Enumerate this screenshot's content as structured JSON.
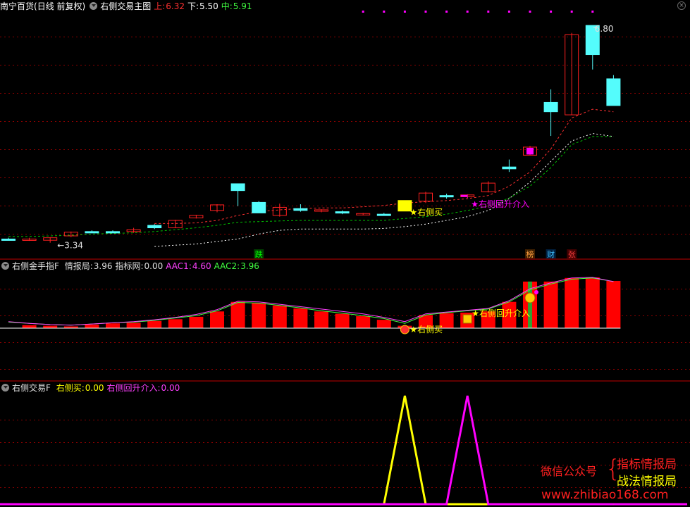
{
  "header": {
    "stock": "南宁百货",
    "period": "(日线 前复权)",
    "indicator": "右侧交易主图",
    "up_label": "上:",
    "up_value": "6.32",
    "down_label": "下:",
    "down_value": "5.50",
    "mid_label": "中:",
    "mid_value": "5.91"
  },
  "panel2": {
    "name": "右侧金手指F",
    "items": [
      {
        "label": "情报局:",
        "value": "3.96",
        "color": "#e0e0e0"
      },
      {
        "label": "指标网:",
        "value": "0.00",
        "color": "#e0e0e0"
      },
      {
        "label": "AAC1:",
        "value": "4.60",
        "color": "#ff40ff"
      },
      {
        "label": "AAC2:",
        "value": "3.96",
        "color": "#40ff40"
      }
    ]
  },
  "panel3": {
    "name": "右侧交易F",
    "items": [
      {
        "label": "右侧买:",
        "value": "0.00",
        "color": "#ffff00"
      },
      {
        "label": "右侧回升介入:",
        "value": "0.00",
        "color": "#ff40ff"
      }
    ]
  },
  "watermark": {
    "wechat": "微信公众号",
    "line1": "指标情报局",
    "line2": "战法情报局",
    "url": "www.zhibiao168.com"
  },
  "colors": {
    "up": "#ff2020",
    "down": "#54fcfc",
    "yellow": "#ffff00",
    "magenta": "#ff00ff",
    "green_line": "#00c000",
    "red_line": "#ff3030",
    "white_line": "#ffffff",
    "grid": "#8b0000"
  },
  "chart_data": [
    {
      "type": "candlestick",
      "title": "右侧交易主图",
      "annotations": {
        "high_label": "6.80",
        "low_label": "3.34",
        "buy_label": "右侧买",
        "rebound_label": "右侧回升介入",
        "tags": [
          {
            "text": "跌",
            "bar": 12,
            "color": "#00ff00",
            "bg": "#004000"
          },
          {
            "text": "榜",
            "bar": 25,
            "color": "#ffa040",
            "bg": "#402000"
          },
          {
            "text": "财",
            "bar": 26,
            "color": "#40c0ff",
            "bg": "#002040"
          },
          {
            "text": "张",
            "bar": 27,
            "color": "#ff4040",
            "bg": "#400000"
          }
        ]
      },
      "ylim": [
        3.28,
        7.0
      ],
      "candles": [
        {
          "o": 3.4,
          "h": 3.42,
          "l": 3.38,
          "c": 3.4,
          "kind": "down"
        },
        {
          "o": 3.38,
          "h": 3.42,
          "l": 3.37,
          "c": 3.4,
          "kind": "up"
        },
        {
          "o": 3.38,
          "h": 3.43,
          "l": 3.34,
          "c": 3.42,
          "kind": "up"
        },
        {
          "o": 3.45,
          "h": 3.52,
          "l": 3.43,
          "c": 3.51,
          "kind": "up"
        },
        {
          "o": 3.52,
          "h": 3.54,
          "l": 3.5,
          "c": 3.52,
          "kind": "down"
        },
        {
          "o": 3.52,
          "h": 3.54,
          "l": 3.5,
          "c": 3.52,
          "kind": "down"
        },
        {
          "o": 3.52,
          "h": 3.58,
          "l": 3.5,
          "c": 3.55,
          "kind": "up"
        },
        {
          "o": 3.62,
          "h": 3.64,
          "l": 3.56,
          "c": 3.58,
          "kind": "down"
        },
        {
          "o": 3.58,
          "h": 3.71,
          "l": 3.58,
          "c": 3.7,
          "kind": "up"
        },
        {
          "o": 3.74,
          "h": 3.79,
          "l": 3.73,
          "c": 3.78,
          "kind": "up"
        },
        {
          "o": 3.86,
          "h": 3.96,
          "l": 3.83,
          "c": 3.95,
          "kind": "up"
        },
        {
          "o": 4.29,
          "h": 4.29,
          "l": 3.93,
          "c": 4.18,
          "kind": "down"
        },
        {
          "o": 3.99,
          "h": 4.01,
          "l": 3.82,
          "c": 3.82,
          "kind": "down"
        },
        {
          "o": 3.78,
          "h": 3.97,
          "l": 3.76,
          "c": 3.91,
          "kind": "up"
        },
        {
          "o": 3.89,
          "h": 3.96,
          "l": 3.84,
          "c": 3.86,
          "kind": "down"
        },
        {
          "o": 3.86,
          "h": 3.88,
          "l": 3.83,
          "c": 3.87,
          "kind": "up"
        },
        {
          "o": 3.84,
          "h": 3.86,
          "l": 3.8,
          "c": 3.83,
          "kind": "down"
        },
        {
          "o": 3.8,
          "h": 3.82,
          "l": 3.78,
          "c": 3.81,
          "kind": "up"
        },
        {
          "o": 3.8,
          "h": 3.82,
          "l": 3.78,
          "c": 3.79,
          "kind": "down"
        },
        {
          "o": 3.85,
          "h": 4.02,
          "l": 3.85,
          "c": 4.02,
          "kind": "buy"
        },
        {
          "o": 4.01,
          "h": 4.16,
          "l": 3.98,
          "c": 4.14,
          "kind": "up"
        },
        {
          "o": 4.1,
          "h": 4.13,
          "l": 4.05,
          "c": 4.08,
          "kind": "down"
        },
        {
          "o": 4.08,
          "h": 4.12,
          "l": 4.06,
          "c": 4.11,
          "kind": "rebound"
        },
        {
          "o": 4.16,
          "h": 4.33,
          "l": 4.15,
          "c": 4.3,
          "kind": "up"
        },
        {
          "o": 4.56,
          "h": 4.68,
          "l": 4.48,
          "c": 4.53,
          "kind": "down"
        },
        {
          "o": 4.75,
          "h": 4.9,
          "l": 4.75,
          "c": 4.88,
          "kind": "magenta"
        },
        {
          "o": 5.6,
          "h": 5.81,
          "l": 5.06,
          "c": 5.45,
          "kind": "down"
        },
        {
          "o": 5.4,
          "h": 6.72,
          "l": 5.4,
          "c": 6.69,
          "kind": "up"
        },
        {
          "o": 6.84,
          "h": 6.84,
          "l": 6.13,
          "c": 6.37,
          "kind": "down"
        },
        {
          "o": 5.98,
          "h": 6.04,
          "l": 5.55,
          "c": 5.55,
          "kind": "down"
        }
      ],
      "green_line": [
        3.44,
        3.44,
        3.45,
        3.46,
        3.48,
        3.49,
        3.5,
        3.52,
        3.55,
        3.58,
        3.62,
        3.67,
        3.68,
        3.69,
        3.7,
        3.7,
        3.7,
        3.7,
        3.7,
        3.73,
        3.76,
        3.8,
        3.86,
        3.93,
        4.06,
        4.25,
        4.55,
        4.92,
        5.05,
        5.05
      ],
      "red_line": [
        null,
        null,
        null,
        null,
        null,
        null,
        null,
        3.65,
        3.65,
        3.66,
        3.7,
        3.78,
        3.84,
        3.87,
        3.89,
        3.9,
        3.9,
        3.92,
        3.94,
        3.98,
        4.0,
        4.02,
        4.05,
        4.1,
        4.25,
        4.48,
        4.85,
        5.35,
        5.49,
        5.45
      ],
      "white_line": [
        null,
        null,
        null,
        null,
        null,
        null,
        null,
        3.28,
        3.3,
        3.32,
        3.36,
        3.4,
        3.48,
        3.54,
        3.56,
        3.56,
        3.56,
        3.56,
        3.57,
        3.6,
        3.64,
        3.7,
        3.76,
        3.86,
        4.05,
        4.32,
        4.65,
        4.98,
        5.1,
        5.05
      ]
    },
    {
      "type": "bar",
      "title": "右侧金手指F",
      "annotations": {
        "buy_label": "右侧买",
        "rebound_label": "右侧回升介入"
      },
      "ylim": [
        3.82,
        4.74
      ],
      "bars": [
        null,
        3.87,
        3.86,
        3.85,
        3.88,
        3.9,
        3.91,
        3.94,
        3.97,
        4.01,
        4.1,
        4.26,
        4.24,
        4.2,
        4.15,
        4.1,
        4.06,
        4.02,
        3.96,
        3.86,
        4.04,
        4.07,
        4.08,
        4.1,
        4.26,
        4.6,
        4.6,
        4.66,
        4.67,
        4.61
      ],
      "bar_colors": [
        null,
        "red",
        "red",
        "red",
        "red",
        "red",
        "red",
        "red",
        "red",
        "red",
        "red",
        "red",
        "red",
        "red",
        "red",
        "red",
        "red",
        "red",
        "red",
        "red",
        "red",
        "red",
        "red",
        "red",
        "red",
        "dual",
        "red",
        "red",
        "red",
        "red"
      ],
      "aac1": [
        3.93,
        3.9,
        3.88,
        3.87,
        3.89,
        3.91,
        3.93,
        3.96,
        4.0,
        4.05,
        4.13,
        4.27,
        4.26,
        4.22,
        4.18,
        4.14,
        4.1,
        4.06,
        4.0,
        3.93,
        4.06,
        4.09,
        4.12,
        4.15,
        4.28,
        4.48,
        4.58,
        4.66,
        4.67,
        4.6
      ],
      "aac2": [
        3.92,
        3.9,
        3.88,
        3.87,
        3.89,
        3.91,
        3.92,
        3.95,
        3.99,
        4.03,
        4.11,
        4.25,
        4.24,
        4.2,
        4.16,
        4.11,
        4.07,
        4.03,
        3.98,
        3.9,
        4.04,
        4.08,
        4.11,
        4.14,
        4.26,
        4.46,
        4.56,
        4.64,
        4.66,
        4.6
      ]
    },
    {
      "type": "line",
      "title": "右侧交易F",
      "series": [
        {
          "name": "右侧买",
          "values": [
            0,
            0,
            0,
            0,
            0,
            0,
            0,
            0,
            0,
            0,
            0,
            0,
            0,
            0,
            0,
            0,
            0,
            0,
            0,
            1,
            0,
            0,
            0,
            0,
            0,
            0,
            0,
            0,
            0,
            0
          ]
        },
        {
          "name": "右侧回升介入",
          "values": [
            0,
            0,
            0,
            0,
            0,
            0,
            0,
            0,
            0,
            0,
            0,
            0,
            0,
            0,
            0,
            0,
            0,
            0,
            0,
            0,
            0,
            0,
            1,
            0,
            0,
            0,
            0,
            0,
            0,
            0
          ]
        }
      ]
    }
  ]
}
